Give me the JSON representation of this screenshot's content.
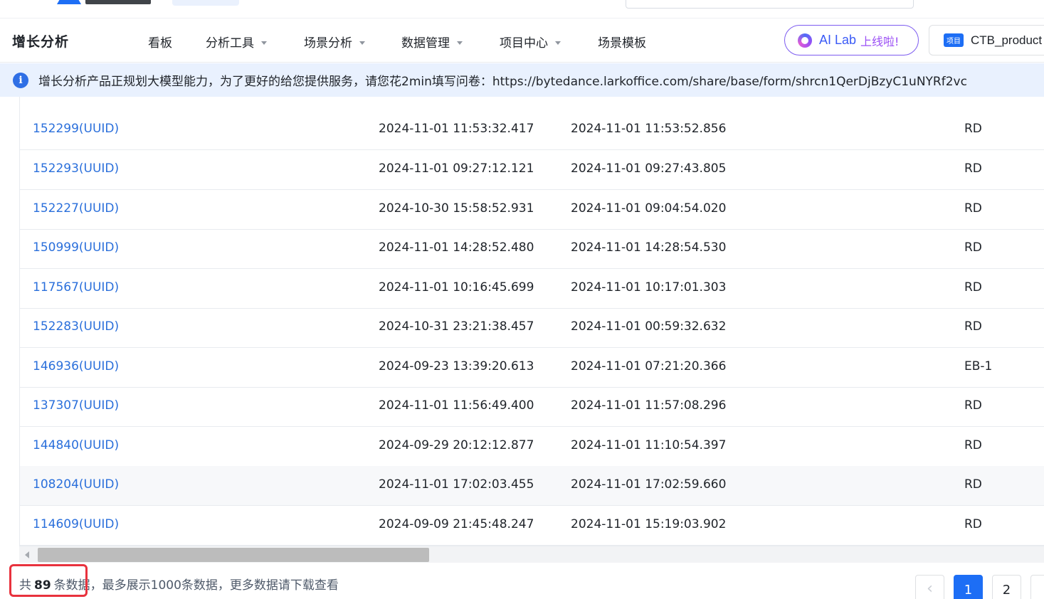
{
  "nav": {
    "brand": "增长分析",
    "items": [
      {
        "label": "看板"
      },
      {
        "label": "分析工具"
      },
      {
        "label": "场景分析"
      },
      {
        "label": "数据管理"
      },
      {
        "label": "项目中心"
      },
      {
        "label": "场景模板"
      }
    ],
    "ailab": {
      "label": "AI Lab",
      "tag": "上线啦!"
    },
    "project": {
      "badge": "项目",
      "name": "CTB_product"
    }
  },
  "notice": {
    "icon": "info-icon",
    "text": "增长分析产品正规划大模型能力，为了更好的给您提供服务，请您花2min填写问卷：https://bytedance.larkoffice.com/share/base/form/shrcn1QerDjBzyC1uNYRf2vc"
  },
  "table": {
    "rows": [
      {
        "id": "152299(UUID)",
        "start": "2024-11-01 11:53:32.417",
        "end": "2024-11-01 11:53:52.856",
        "role": "RD"
      },
      {
        "id": "152293(UUID)",
        "start": "2024-11-01 09:27:12.121",
        "end": "2024-11-01 09:27:43.805",
        "role": "RD"
      },
      {
        "id": "152227(UUID)",
        "start": "2024-10-30 15:58:52.931",
        "end": "2024-11-01 09:04:54.020",
        "role": "RD"
      },
      {
        "id": "150999(UUID)",
        "start": "2024-11-01 14:28:52.480",
        "end": "2024-11-01 14:28:54.530",
        "role": "RD"
      },
      {
        "id": "117567(UUID)",
        "start": "2024-11-01 10:16:45.699",
        "end": "2024-11-01 10:17:01.303",
        "role": "RD"
      },
      {
        "id": "152283(UUID)",
        "start": "2024-10-31 23:21:38.457",
        "end": "2024-11-01 00:59:32.632",
        "role": "RD"
      },
      {
        "id": "146936(UUID)",
        "start": "2024-09-23 13:39:20.613",
        "end": "2024-11-01 07:21:20.366",
        "role": "EB-1"
      },
      {
        "id": "137307(UUID)",
        "start": "2024-11-01 11:56:49.400",
        "end": "2024-11-01 11:57:08.296",
        "role": "RD"
      },
      {
        "id": "144840(UUID)",
        "start": "2024-09-29 20:12:12.877",
        "end": "2024-11-01 11:10:54.397",
        "role": "RD"
      },
      {
        "id": "108204(UUID)",
        "start": "2024-11-01 17:02:03.455",
        "end": "2024-11-01 17:02:59.660",
        "role": "RD"
      },
      {
        "id": "114609(UUID)",
        "start": "2024-09-09 21:45:48.247",
        "end": "2024-11-01 15:19:03.902",
        "role": "RD"
      }
    ]
  },
  "footer": {
    "summary_prefix": "共",
    "total": "89",
    "summary_suffix": "条数据，最多展示1000条数据，更多数据请下载查看",
    "pages": [
      "1",
      "2"
    ],
    "prev_icon": "‹"
  },
  "colors": {
    "accent": "#1d6ef5",
    "link": "#2a6fdb",
    "highlight_border": "#e8323d",
    "notice_bg": "#e9f1fe"
  }
}
